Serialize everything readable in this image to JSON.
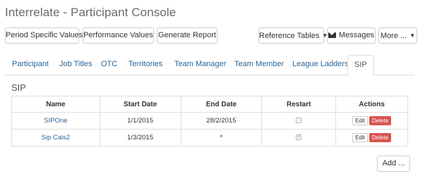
{
  "header": {
    "title": "Interrelate - Participant Console"
  },
  "toolbar": {
    "period_values": "Period Specific Values",
    "performance_values": "Performance Values",
    "generate_report": "Generate Report",
    "reference_tables": "Reference Tables",
    "messages": "Messages",
    "more": "More ..."
  },
  "tabs": [
    {
      "label": "Participant"
    },
    {
      "label": "Job Titles"
    },
    {
      "label": "OTC"
    },
    {
      "label": "Territories"
    },
    {
      "label": "Team Manager"
    },
    {
      "label": "Team Member"
    },
    {
      "label": "League Ladders"
    },
    {
      "label": "SIP"
    }
  ],
  "active_tab": "SIP",
  "section": {
    "title": "SIP"
  },
  "table": {
    "headers": [
      "Name",
      "Start Date",
      "End Date",
      "Restart",
      "Actions"
    ],
    "rows": [
      {
        "name": "SIPOne",
        "start": "1/1/2015",
        "end": "28/2/2015",
        "restart": false
      },
      {
        "name": "Sip Cals2",
        "start": "1/3/2015",
        "end": "*",
        "restart": true
      }
    ],
    "edit_label": "Edit",
    "delete_label": "Delete"
  },
  "footer": {
    "add_label": "Add ..."
  },
  "icons": {
    "messages": "envelope-icon",
    "dropdown": "caret-down-icon"
  },
  "colors": {
    "link": "#2a6496",
    "delete": "#d9534f",
    "border": "#dddddd"
  }
}
